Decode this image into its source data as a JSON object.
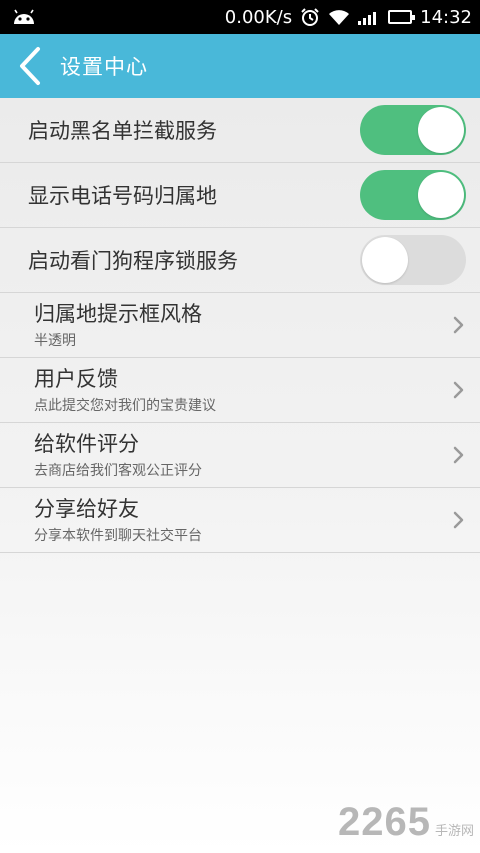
{
  "status_bar": {
    "speed": "0.00K/s",
    "time": "14:32",
    "icons": [
      "android-icon",
      "alarm-icon",
      "wifi-icon",
      "signal-icon",
      "battery-icon"
    ]
  },
  "header": {
    "title": "设置中心"
  },
  "toggles": [
    {
      "label": "启动黑名单拦截服务",
      "on": true
    },
    {
      "label": "显示电话号码归属地",
      "on": true
    },
    {
      "label": "启动看门狗程序锁服务",
      "on": false
    }
  ],
  "items": [
    {
      "title": "归属地提示框风格",
      "subtitle": "半透明"
    },
    {
      "title": "用户反馈",
      "subtitle": "点此提交您对我们的宝贵建议"
    },
    {
      "title": "给软件评分",
      "subtitle": "去商店给我们客观公正评分"
    },
    {
      "title": "分享给好友",
      "subtitle": "分享本软件到聊天社交平台"
    }
  ],
  "watermark": {
    "big": "2265",
    "small": "手游网"
  },
  "colors": {
    "accent": "#49b8d9",
    "toggle_on": "#4fbf7f",
    "toggle_off": "#dcdcdc"
  }
}
